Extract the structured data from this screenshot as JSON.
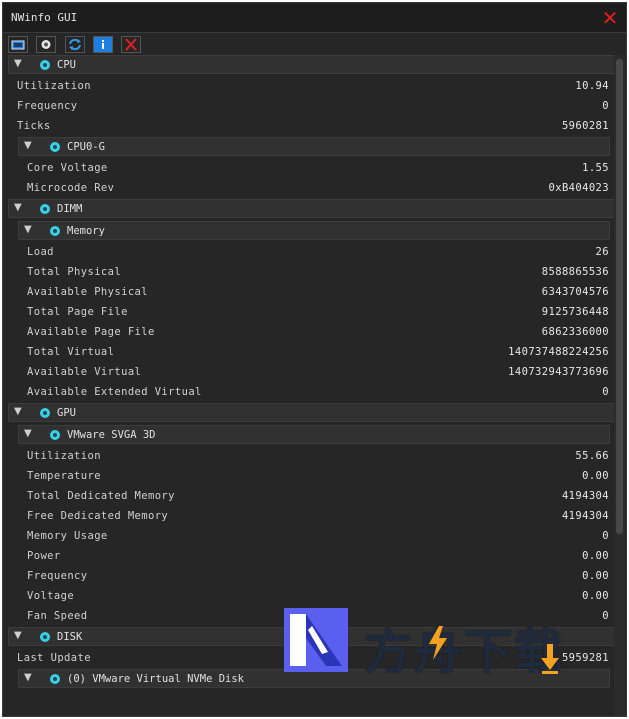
{
  "window": {
    "title": "NWinfo GUI"
  },
  "colors": {
    "background": "#262626",
    "header": "#313131",
    "close": "#e01e1e",
    "gear": "#3ad0e6"
  },
  "icons": [
    "screenshot-icon",
    "settings-icon",
    "refresh-icon",
    "info-icon",
    "close-icon"
  ],
  "cpu": {
    "label": "CPU",
    "rows": [
      {
        "k": "Utilization",
        "v": "10.94"
      },
      {
        "k": "Frequency",
        "v": "0"
      },
      {
        "k": "Ticks",
        "v": "5960281"
      }
    ],
    "sub": {
      "label": "CPU0-G",
      "rows": [
        {
          "k": "Core Voltage",
          "v": "1.55"
        },
        {
          "k": "Microcode Rev",
          "v": "0xB404023"
        }
      ]
    }
  },
  "dimm": {
    "label": "DIMM",
    "sub": {
      "label": "Memory",
      "rows": [
        {
          "k": "Load",
          "v": "26"
        },
        {
          "k": "Total Physical",
          "v": "8588865536"
        },
        {
          "k": "Available Physical",
          "v": "6343704576"
        },
        {
          "k": "Total Page File",
          "v": "9125736448"
        },
        {
          "k": "Available Page File",
          "v": "6862336000"
        },
        {
          "k": "Total Virtual",
          "v": "140737488224256"
        },
        {
          "k": "Available Virtual",
          "v": "140732943773696"
        },
        {
          "k": "Available Extended Virtual",
          "v": "0"
        }
      ]
    }
  },
  "gpu": {
    "label": "GPU",
    "sub": {
      "label": "VMware SVGA 3D",
      "rows": [
        {
          "k": "Utilization",
          "v": "55.66"
        },
        {
          "k": "Temperature",
          "v": "0.00"
        },
        {
          "k": "Total Dedicated Memory",
          "v": "4194304"
        },
        {
          "k": "Free Dedicated Memory",
          "v": "4194304"
        },
        {
          "k": "Memory Usage",
          "v": "0"
        },
        {
          "k": "Power",
          "v": "0.00"
        },
        {
          "k": "Frequency",
          "v": "0.00"
        },
        {
          "k": "Voltage",
          "v": "0.00"
        },
        {
          "k": "Fan Speed",
          "v": "0"
        }
      ]
    }
  },
  "disk": {
    "label": "DISK",
    "rows": [
      {
        "k": "Last Update",
        "v": "5959281"
      }
    ],
    "sub": {
      "label": "(0) VMware Virtual NVMe Disk"
    }
  },
  "watermark": {
    "text": "方舟下载"
  }
}
